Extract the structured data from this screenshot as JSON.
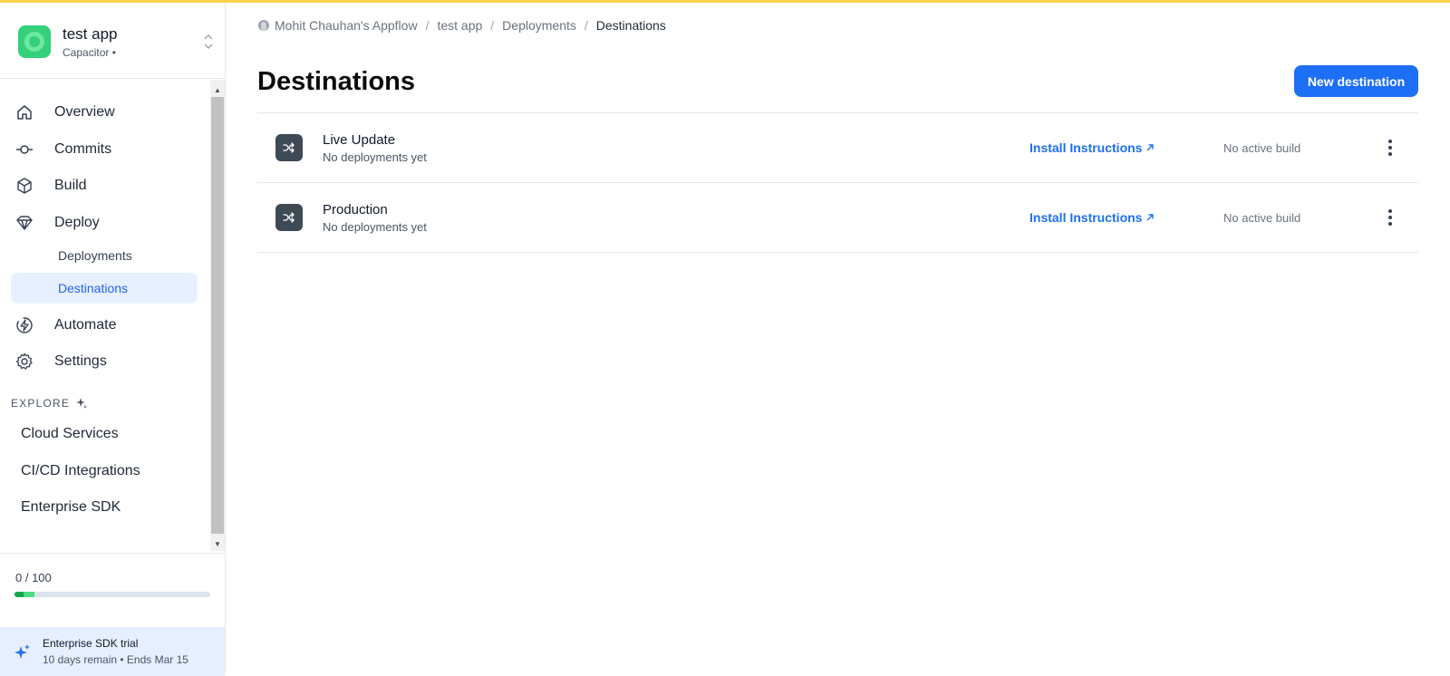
{
  "app": {
    "name": "test app",
    "subtitle": "Capacitor •"
  },
  "nav": {
    "items": [
      {
        "label": "Overview",
        "icon": "home-icon"
      },
      {
        "label": "Commits",
        "icon": "commit-icon"
      },
      {
        "label": "Build",
        "icon": "cube-icon"
      },
      {
        "label": "Deploy",
        "icon": "diamond-icon"
      }
    ],
    "deploy_sub": [
      {
        "label": "Deployments",
        "active": false
      },
      {
        "label": "Destinations",
        "active": true
      }
    ],
    "more_items": [
      {
        "label": "Automate",
        "icon": "bolt-icon"
      },
      {
        "label": "Settings",
        "icon": "gear-icon"
      }
    ],
    "explore_label": "EXPLORE",
    "explore_items": [
      {
        "label": "Cloud Services"
      },
      {
        "label": "CI/CD Integrations"
      },
      {
        "label": "Enterprise SDK"
      }
    ]
  },
  "usage": {
    "text": "0 / 100",
    "fill_percent": 10
  },
  "trial": {
    "title": "Enterprise SDK trial",
    "subtitle": "10 days remain • Ends Mar 15"
  },
  "breadcrumb": {
    "items": [
      "Mohit Chauhan's Appflow",
      "test app",
      "Deployments"
    ],
    "current": "Destinations",
    "separator": "/"
  },
  "page": {
    "title": "Destinations",
    "new_button": "New destination"
  },
  "destinations": [
    {
      "name": "Live Update",
      "sub": "No deployments yet",
      "install": "Install Instructions",
      "status": "No active build"
    },
    {
      "name": "Production",
      "sub": "No deployments yet",
      "install": "Install Instructions",
      "status": "No active build"
    }
  ],
  "colors": {
    "accent": "#1d6ff5",
    "top_bar": "#fcd34d",
    "active_bg": "#e6f0ff",
    "trial_bg": "#e6efff"
  }
}
